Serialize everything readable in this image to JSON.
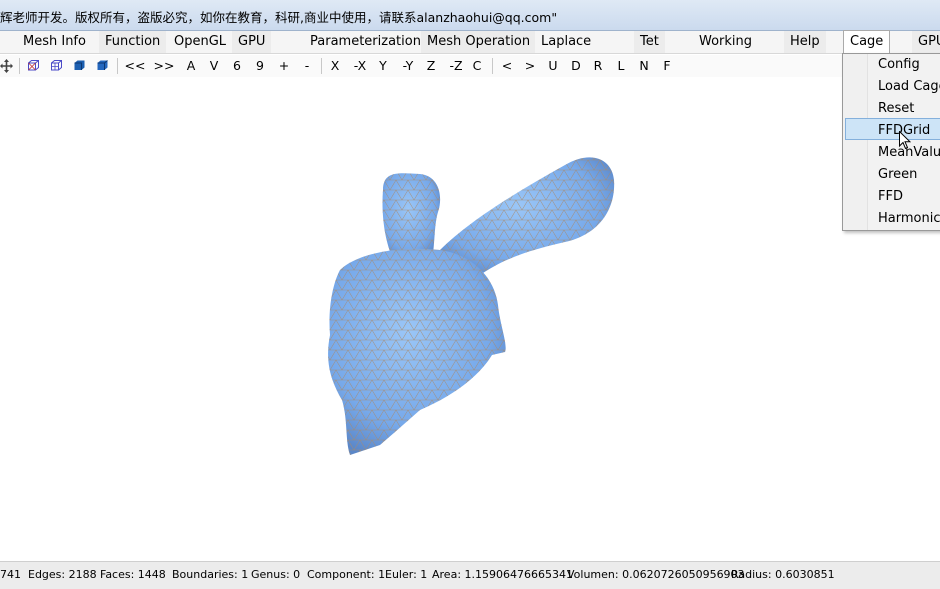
{
  "window": {
    "title": "辉老师开发。版权所有，盗版必究，如你在教育，科研,商业中使用，请联系alanzhaohui@qq.com\""
  },
  "menubar": {
    "items": [
      "Mesh Info",
      "Function",
      "OpenGL",
      "GPU",
      "Parameterization",
      "Mesh Operation",
      "Laplace",
      "Tet",
      "Working",
      "Help",
      "Cage",
      "GPU"
    ]
  },
  "toolbar": {
    "icons": [
      "move-icon",
      "wireframe-cube-icon",
      "wireframe-cube-2-icon",
      "solid-cube-icon",
      "solid-cube-2-icon"
    ],
    "buttons": [
      "<<",
      ">>",
      "A",
      "V",
      "6",
      "9",
      "+",
      "-",
      "X",
      "-X",
      "Y",
      "-Y",
      "Z",
      "-Z",
      "C",
      "<",
      ">",
      "U",
      "D",
      "R",
      "L",
      "N",
      "F"
    ]
  },
  "cage_menu": {
    "items": [
      "Config",
      "Load Cage",
      "Reset",
      "FFDGrid",
      "MeanValue",
      "Green",
      "FFD",
      "Harmonic"
    ],
    "highlighted": "FFDGrid"
  },
  "model": {
    "fill_color": "#7fb1ee",
    "edge_color": "#b09070"
  },
  "status": {
    "vertices": "741",
    "edges": "Edges: 2188",
    "faces": "Faces: 1448",
    "boundaries": "Boundaries: 1",
    "genus": "Genus: 0",
    "component": "Component: 1",
    "euler": "Euler: 1",
    "area": "Area: 1.15906476665341",
    "volume": "Volumen: 0.0620726050956903",
    "radius": "Radius: 0.6030851"
  }
}
